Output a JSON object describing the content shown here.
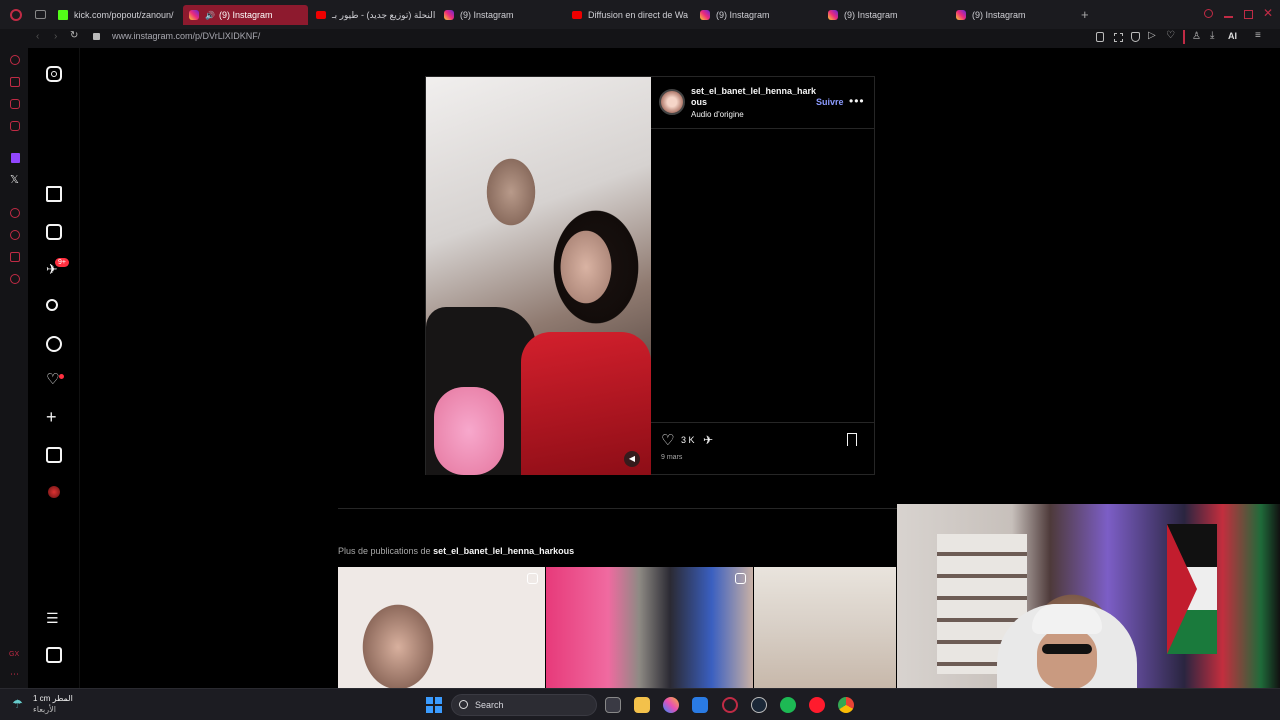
{
  "browser": {
    "tabs": [
      {
        "label": "kick.com/popout/zanoun/",
        "icon": "kick-icon"
      },
      {
        "label": "(9) Instagram",
        "icon": "instagram-icon",
        "active": true,
        "audio": true
      },
      {
        "label": "النحلة (توزيع جديد) - طيور بـ",
        "icon": "youtube-icon"
      },
      {
        "label": "(9) Instagram",
        "icon": "instagram-icon"
      },
      {
        "label": "Diffusion en direct de Wa",
        "icon": "youtube-icon"
      },
      {
        "label": "(9) Instagram",
        "icon": "instagram-icon"
      },
      {
        "label": "(9) Instagram",
        "icon": "instagram-icon"
      },
      {
        "label": "(9) Instagram",
        "icon": "instagram-icon"
      }
    ],
    "url": "www.instagram.com/p/DVrLlXIDKNF/",
    "ai_label": "AI",
    "accent": "#c02b45"
  },
  "nav": {
    "notification_badge": "9+"
  },
  "post": {
    "username": "set_el_banet_lel_henna_harkous",
    "audio": "Audio d'origine",
    "follow": "Suivre",
    "likes": "3 K",
    "date": "9 mars",
    "follow_color": "#8c9bff"
  },
  "more": {
    "prefix": "Plus de publications de",
    "username": "set_el_banet_lel_henna_harkous"
  },
  "taskbar": {
    "weather_line1": "1 cm المطر",
    "weather_line2": "الأربعاء",
    "search": "Search"
  }
}
